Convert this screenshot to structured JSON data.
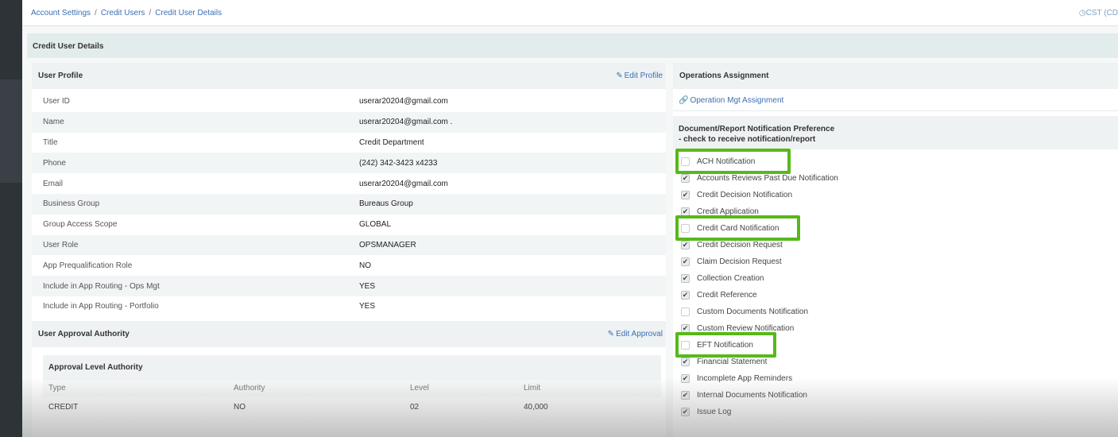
{
  "breadcrumb": [
    "Account Settings",
    "Credit Users",
    "Credit User Details"
  ],
  "timezone": "CST (CD",
  "panel_title": "Credit User Details",
  "user_profile": {
    "title": "User Profile",
    "edit_label": "Edit Profile",
    "rows": [
      {
        "label": "User ID",
        "value": "userar20204@gmail.com"
      },
      {
        "label": "Name",
        "value": "userar20204@gmail.com ."
      },
      {
        "label": "Title",
        "value": "Credit Department"
      },
      {
        "label": "Phone",
        "value": "(242) 342-3423 x4233"
      },
      {
        "label": "Email",
        "value": "userar20204@gmail.com"
      },
      {
        "label": "Business Group",
        "value": "Bureaus Group"
      },
      {
        "label": "Group Access Scope",
        "value": "GLOBAL"
      },
      {
        "label": "User Role",
        "value": "OPSMANAGER"
      },
      {
        "label": "App Prequalification Role",
        "value": "NO"
      },
      {
        "label": "Include in App Routing - Ops Mgt",
        "value": "YES"
      },
      {
        "label": "Include in App Routing - Portfolio",
        "value": "YES"
      }
    ]
  },
  "approval": {
    "title": "User Approval Authority",
    "edit_label": "Edit Approval",
    "box_title": "Approval Level Authority",
    "columns": [
      "Type",
      "Authority",
      "Level",
      "Limit"
    ],
    "rows": [
      [
        "CREDIT",
        "NO",
        "02",
        "40,000"
      ]
    ]
  },
  "operations": {
    "title": "Operations Assignment",
    "link_label": "Operation Mgt Assignment"
  },
  "notifications": {
    "title_line1": "Document/Report Notification Preference",
    "title_line2": "- check to receive notification/report",
    "items": [
      {
        "label": "ACH Notification",
        "checked": false,
        "highlighted": true
      },
      {
        "label": "Accounts Reviews Past Due Notification",
        "checked": true,
        "highlighted": false
      },
      {
        "label": "Credit Decision Notification",
        "checked": true,
        "highlighted": false
      },
      {
        "label": "Credit Application",
        "checked": true,
        "highlighted": false
      },
      {
        "label": "Credit Card Notification",
        "checked": false,
        "highlighted": true
      },
      {
        "label": "Credit Decision Request",
        "checked": true,
        "highlighted": false
      },
      {
        "label": "Claim Decision Request",
        "checked": true,
        "highlighted": false
      },
      {
        "label": "Collection Creation",
        "checked": true,
        "highlighted": false
      },
      {
        "label": "Credit Reference",
        "checked": true,
        "highlighted": false
      },
      {
        "label": "Custom Documents Notification",
        "checked": false,
        "highlighted": false
      },
      {
        "label": "Custom Review Notification",
        "checked": true,
        "highlighted": false
      },
      {
        "label": "EFT Notification",
        "checked": false,
        "highlighted": true
      },
      {
        "label": "Financial Statement",
        "checked": true,
        "highlighted": false
      },
      {
        "label": "Incomplete App Reminders",
        "checked": true,
        "highlighted": false
      },
      {
        "label": "Internal Documents Notification",
        "checked": true,
        "highlighted": false
      },
      {
        "label": "Issue Log",
        "checked": true,
        "highlighted": false
      }
    ]
  },
  "colors": {
    "highlight": "#58b81a",
    "link": "#3b6fb6",
    "section_bg": "#eef2f3"
  },
  "icons": {
    "edit": "edit-icon",
    "link": "link-icon",
    "clock": "clock-icon",
    "check": "check-icon"
  }
}
